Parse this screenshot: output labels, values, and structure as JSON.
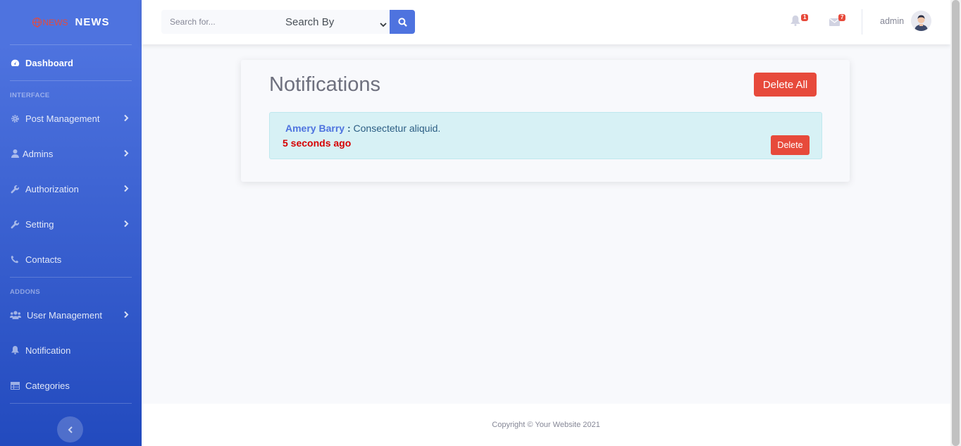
{
  "brand": {
    "logo_text": "NEWS",
    "title": "NEWS"
  },
  "sidebar": {
    "dashboard": "Dashboard",
    "heading_interface": "INTERFACE",
    "items_interface": [
      {
        "label": "Post Management",
        "icon": "cog-icon",
        "has_arrow": true
      },
      {
        "label": "Admins",
        "icon": "user-icon",
        "has_arrow": true
      },
      {
        "label": "Authorization",
        "icon": "wrench-icon",
        "has_arrow": true
      },
      {
        "label": "Setting",
        "icon": "wrench-icon",
        "has_arrow": true
      },
      {
        "label": "Contacts",
        "icon": "phone-icon",
        "has_arrow": false
      }
    ],
    "heading_addons": "ADDONS",
    "items_addons": [
      {
        "label": "User Management",
        "icon": "users-icon",
        "has_arrow": true
      },
      {
        "label": "Notification",
        "icon": "bell-icon",
        "has_arrow": false
      },
      {
        "label": "Categories",
        "icon": "table-icon",
        "has_arrow": false
      }
    ]
  },
  "topbar": {
    "search_placeholder": "Search for...",
    "search_by": "Search By",
    "alerts_count": "1",
    "messages_count": "7",
    "user_name": "admin"
  },
  "main": {
    "title": "Notifications",
    "delete_all": "Delete All",
    "notification": {
      "author": "Amery Barry",
      "separator": ":",
      "message": "Consectetur aliquid.",
      "time": "5 seconds ago",
      "delete": "Delete"
    }
  },
  "footer": {
    "copyright": "Copyright © Your Website 2021"
  },
  "colors": {
    "primary": "#4e73df",
    "danger": "#e74a3b",
    "info_bg": "#d7f1f5",
    "time": "#d60000"
  }
}
